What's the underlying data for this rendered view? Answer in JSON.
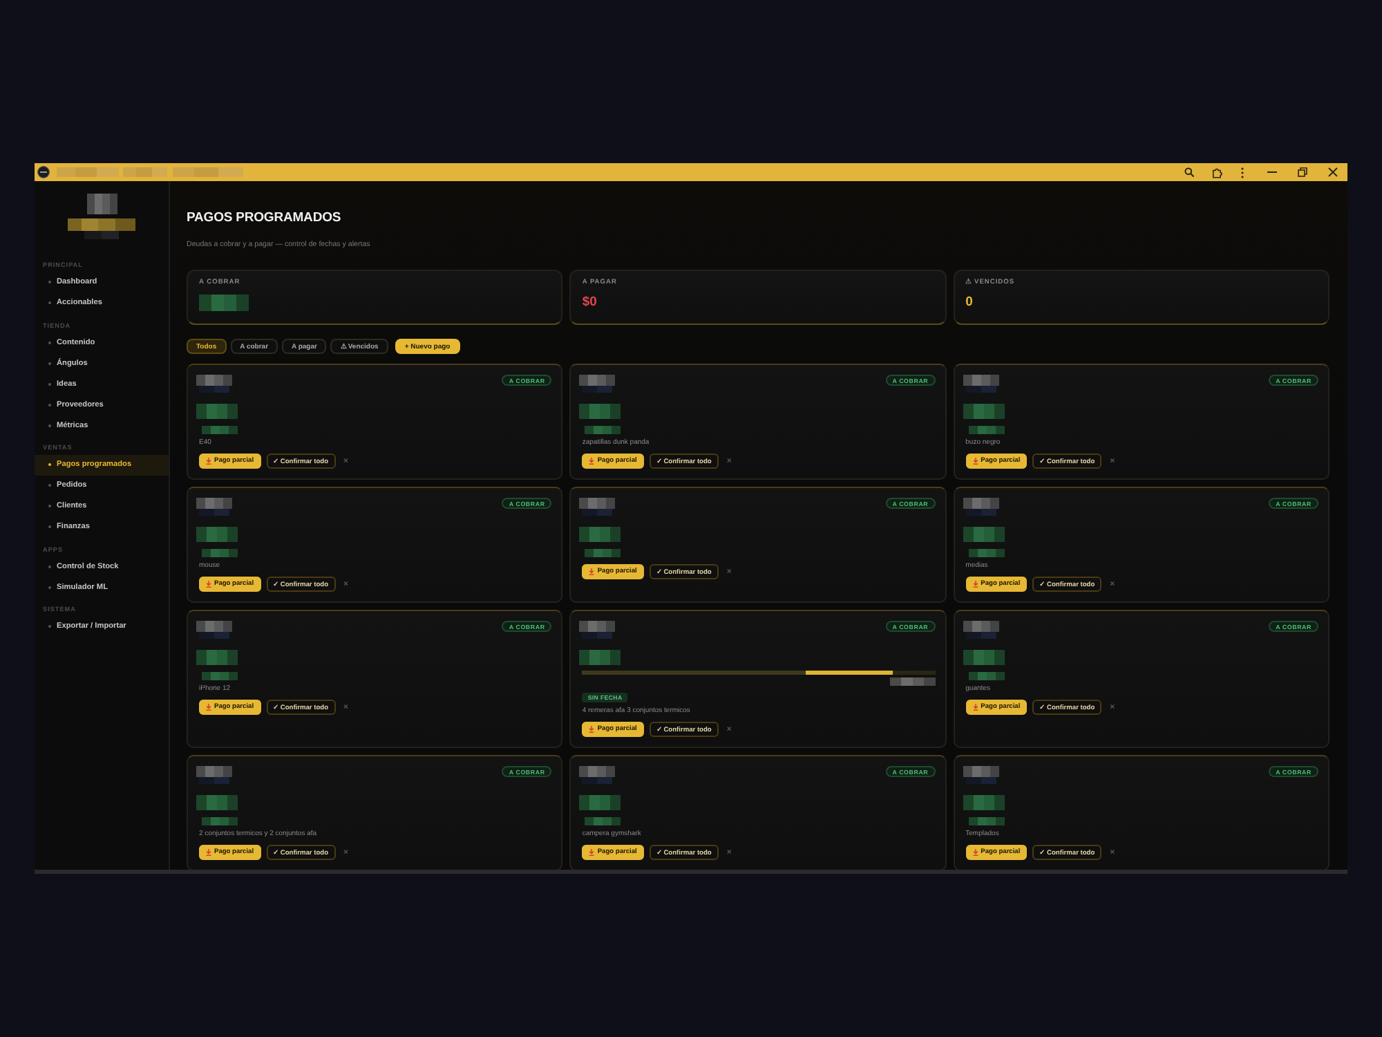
{
  "sidebar": {
    "sections": [
      {
        "label": "PRINCIPAL",
        "items": [
          {
            "label": "Dashboard",
            "selected": false
          },
          {
            "label": "Accionables",
            "selected": false
          }
        ]
      },
      {
        "label": "TIENDA",
        "items": [
          {
            "label": "Contenido",
            "selected": false
          },
          {
            "label": "Ángulos",
            "selected": false
          },
          {
            "label": "Ideas",
            "selected": false
          },
          {
            "label": "Proveedores",
            "selected": false
          },
          {
            "label": "Métricas",
            "selected": false
          }
        ]
      },
      {
        "label": "VENTAS",
        "items": [
          {
            "label": "Pagos programados",
            "selected": true
          },
          {
            "label": "Pedidos",
            "selected": false
          },
          {
            "label": "Clientes",
            "selected": false
          },
          {
            "label": "Finanzas",
            "selected": false
          }
        ]
      },
      {
        "label": "APPS",
        "items": [
          {
            "label": "Control de Stock",
            "selected": false
          },
          {
            "label": "Simulador ML",
            "selected": false
          }
        ]
      },
      {
        "label": "SISTEMA",
        "items": [
          {
            "label": "Exportar / Importar",
            "selected": false
          }
        ]
      }
    ]
  },
  "header": {
    "title": "PAGOS PROGRAMADOS",
    "subtitle": "Deudas a cobrar y a pagar — control de fechas y alertas"
  },
  "stats": [
    {
      "label": "A COBRAR",
      "kind": "collect"
    },
    {
      "label": "A PAGAR",
      "value": "$0",
      "kind": "pay"
    },
    {
      "label": "⚠ VENCIDOS",
      "value": "0",
      "kind": "overdue"
    }
  ],
  "filters": [
    {
      "label": "Todos",
      "kind": "filter",
      "selected": true
    },
    {
      "label": "A cobrar",
      "kind": "filter",
      "selected": false
    },
    {
      "label": "A pagar",
      "kind": "filter",
      "selected": false
    },
    {
      "label": "⚠ Vencidos",
      "kind": "filter",
      "selected": false
    },
    {
      "label": "+ Nuevo pago",
      "kind": "action"
    }
  ],
  "payments": [
    {
      "badge": "A COBRAR",
      "description": "E40",
      "buttons": [
        "Pago parcial",
        "✓ Confirmar todo",
        "×"
      ]
    },
    {
      "badge": "A COBRAR",
      "description": "zapatillas dunk panda",
      "buttons": [
        "Pago parcial",
        "✓ Confirmar todo",
        "×"
      ]
    },
    {
      "badge": "A COBRAR",
      "description": "buzo negro",
      "buttons": [
        "Pago parcial",
        "✓ Confirmar todo",
        "×"
      ]
    },
    {
      "badge": "A COBRAR",
      "description": "mouse",
      "buttons": [
        "Pago parcial",
        "✓ Confirmar todo",
        "×"
      ]
    },
    {
      "badge": "A COBRAR",
      "buttons": [
        "Pago parcial",
        "✓ Confirmar todo",
        "×"
      ]
    },
    {
      "badge": "A COBRAR",
      "description": "medias",
      "buttons": [
        "Pago parcial",
        "✓ Confirmar todo",
        "×"
      ]
    },
    {
      "badge": "A COBRAR",
      "description": "iPhone 12",
      "buttons": [
        "Pago parcial",
        "✓ Confirmar todo",
        "×"
      ]
    },
    {
      "badge": "A COBRAR",
      "progress": {
        "level": 0.88
      },
      "tag": "SIN FECHA",
      "description": "4 remeras afa 3 conjuntos termicos",
      "buttons": [
        "Pago parcial",
        "✓ Confirmar todo",
        "×"
      ]
    },
    {
      "badge": "A COBRAR",
      "description": "guantes",
      "buttons": [
        "Pago parcial",
        "✓ Confirmar todo",
        "×"
      ]
    },
    {
      "badge": "A COBRAR",
      "description": "2 conjuntos termicos y 2 conjuntos afa",
      "buttons": [
        "Pago parcial",
        "✓ Confirmar todo",
        "×"
      ]
    },
    {
      "badge": "A COBRAR",
      "description": "campera gymshark",
      "buttons": [
        "Pago parcial",
        "✓ Confirmar todo",
        "×"
      ]
    },
    {
      "badge": "A COBRAR",
      "description": "Templados",
      "buttons": [
        "Pago parcial",
        "✓ Confirmar todo",
        "×"
      ]
    }
  ]
}
